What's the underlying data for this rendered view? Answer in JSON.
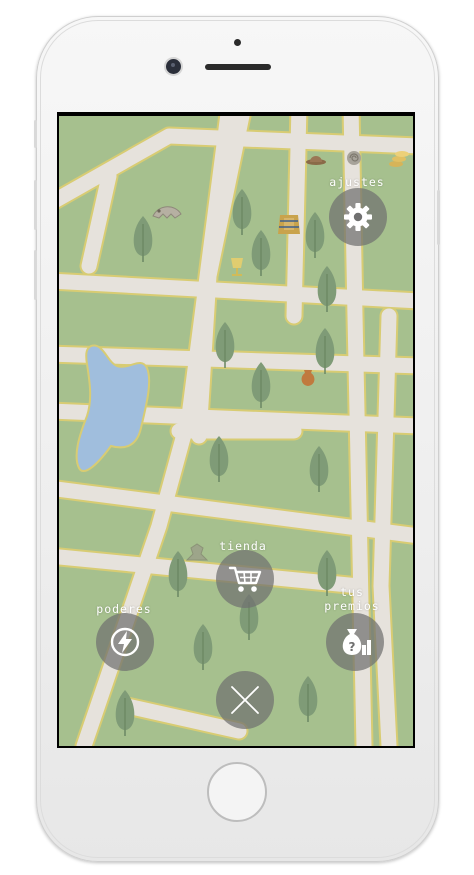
{
  "controls": {
    "settings": {
      "label": "ajustes",
      "icon": "gear-icon"
    },
    "shop": {
      "label": "tienda",
      "icon": "cart-icon"
    },
    "powers": {
      "label": "poderes",
      "icon": "lightning-icon"
    },
    "prizes": {
      "label": "tus\npremios",
      "icon": "prize-bag-icon"
    },
    "close": {
      "icon": "close-icon"
    }
  },
  "map": {
    "colors": {
      "grass": "#a6c08e",
      "road": "#e6e2dc",
      "road_edge": "#d8cc73",
      "water": "#a0bedd",
      "tree": "#7f9b77"
    },
    "collectibles": [
      "hat-icon",
      "spiral-shell-icon",
      "coins-icon",
      "fossil-icon",
      "pharaoh-mask-icon",
      "trophy-cup-icon",
      "vase-icon",
      "dinosaur-bone-icon"
    ]
  }
}
